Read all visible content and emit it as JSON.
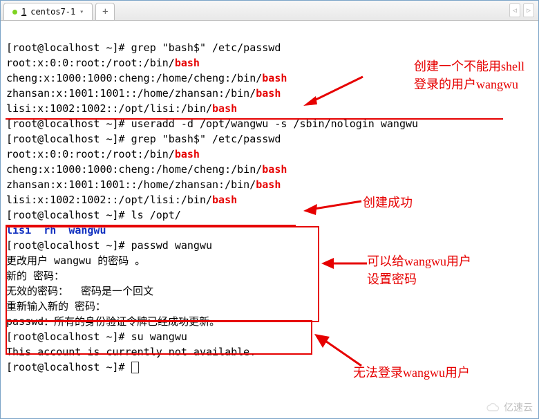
{
  "tab": {
    "index": "1",
    "title": "centos7-1",
    "add": "+"
  },
  "arrows": {
    "left": "◁",
    "right": "▷"
  },
  "lines": {
    "l1a": "[root@localhost ~]# grep \"bash$\" /etc/passwd",
    "l2a": "root:x:0:0:root:/root:/bin/",
    "l2b": "bash",
    "l3a": "cheng:x:1000:1000:cheng:/home/cheng:/bin/",
    "l3b": "bash",
    "l4a": "zhansan:x:1001:1001::/home/zhansan:/bin/",
    "l4b": "bash",
    "l5a": "lisi:x:1002:1002::/opt/lisi:/bin/",
    "l5b": "bash",
    "l6": "[root@localhost ~]# useradd -d /opt/wangwu -s /sbin/nologin wangwu",
    "l7": "[root@localhost ~]# grep \"bash$\" /etc/passwd",
    "l8a": "root:x:0:0:root:/root:/bin/",
    "l8b": "bash",
    "l9a": "cheng:x:1000:1000:cheng:/home/cheng:/bin/",
    "l9b": "bash",
    "l10a": "zhansan:x:1001:1001::/home/zhansan:/bin/",
    "l10b": "bash",
    "l11a": "lisi:x:1002:1002::/opt/lisi:/bin/",
    "l11b": "bash",
    "l12": "[root@localhost ~]# ls /opt/",
    "l13a": "lisi",
    "l13b": "  ",
    "l13c": "rh",
    "l13d": "  ",
    "l13e": "wangwu",
    "l14": "[root@localhost ~]# passwd wangwu",
    "l15": "更改用户 wangwu 的密码 。",
    "l16": "新的 密码：",
    "l17": "无效的密码：  密码是一个回文",
    "l18": "重新输入新的 密码：",
    "l19": "passwd：所有的身份验证令牌已经成功更新。",
    "l20": "[root@localhost ~]# su wangwu",
    "l21": "This account is currently not available.",
    "l22": "[root@localhost ~]# "
  },
  "ann": {
    "a1l1": "创建一个不能用shell",
    "a1l2": "登录的用户wangwu",
    "a2": "创建成功",
    "a3l1": "可以给wangwu用户",
    "a3l2": "设置密码",
    "a4": "无法登录wangwu用户"
  },
  "watermark": "亿速云"
}
